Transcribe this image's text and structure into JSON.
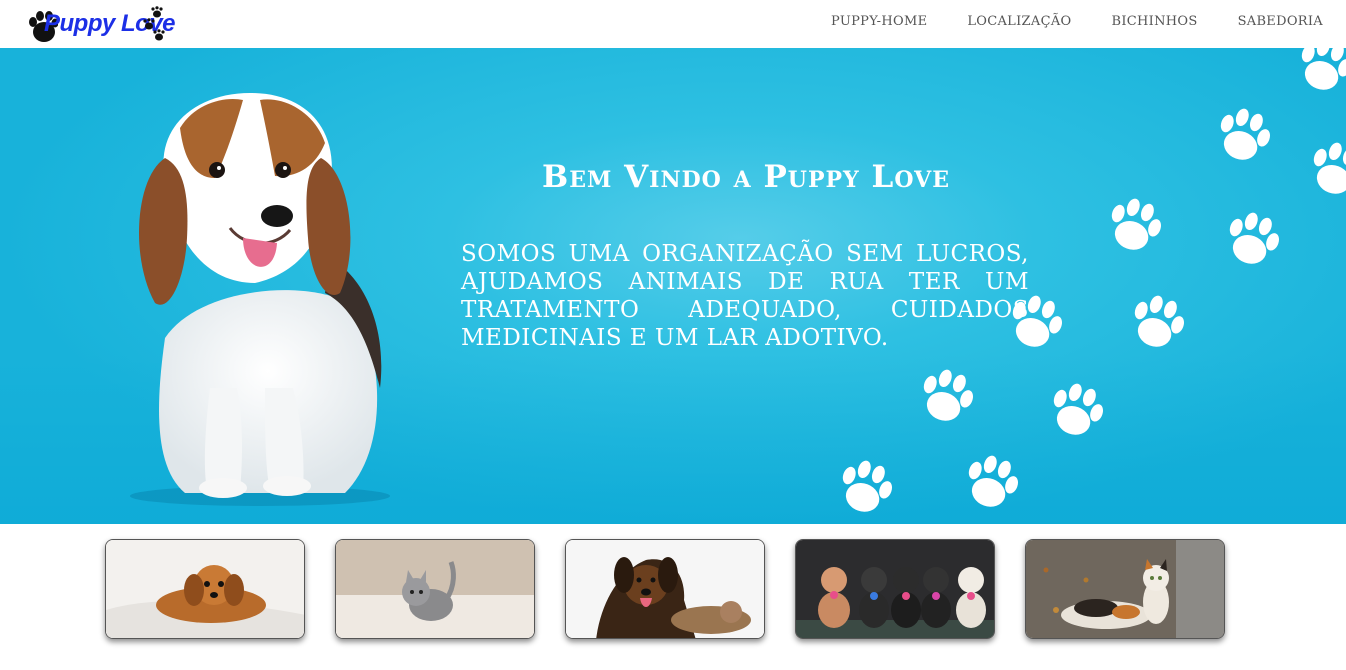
{
  "brand": {
    "name": "Puppy Love",
    "color": "#1c2fe6"
  },
  "nav": {
    "items": [
      {
        "label": "PUPPY-HOME"
      },
      {
        "label": "LOCALIZAÇÃO"
      },
      {
        "label": "BICHINHOS"
      },
      {
        "label": "SABEDORIA"
      }
    ]
  },
  "hero": {
    "title": "Bem Vindo a Puppy Love",
    "text": "Somos uma organização sem lucros, ajudamos animais de rua ter um tratamento adequado, cuidados medicinais e um lar adotivo.",
    "background_color": "#18b2da"
  },
  "gallery": {
    "items": [
      {
        "icon": "puppy-on-bed-photo"
      },
      {
        "icon": "gray-kitten-photo"
      },
      {
        "icon": "dog-and-cat-photo"
      },
      {
        "icon": "puppies-with-bows-photo"
      },
      {
        "icon": "calico-cat-photo"
      }
    ]
  }
}
